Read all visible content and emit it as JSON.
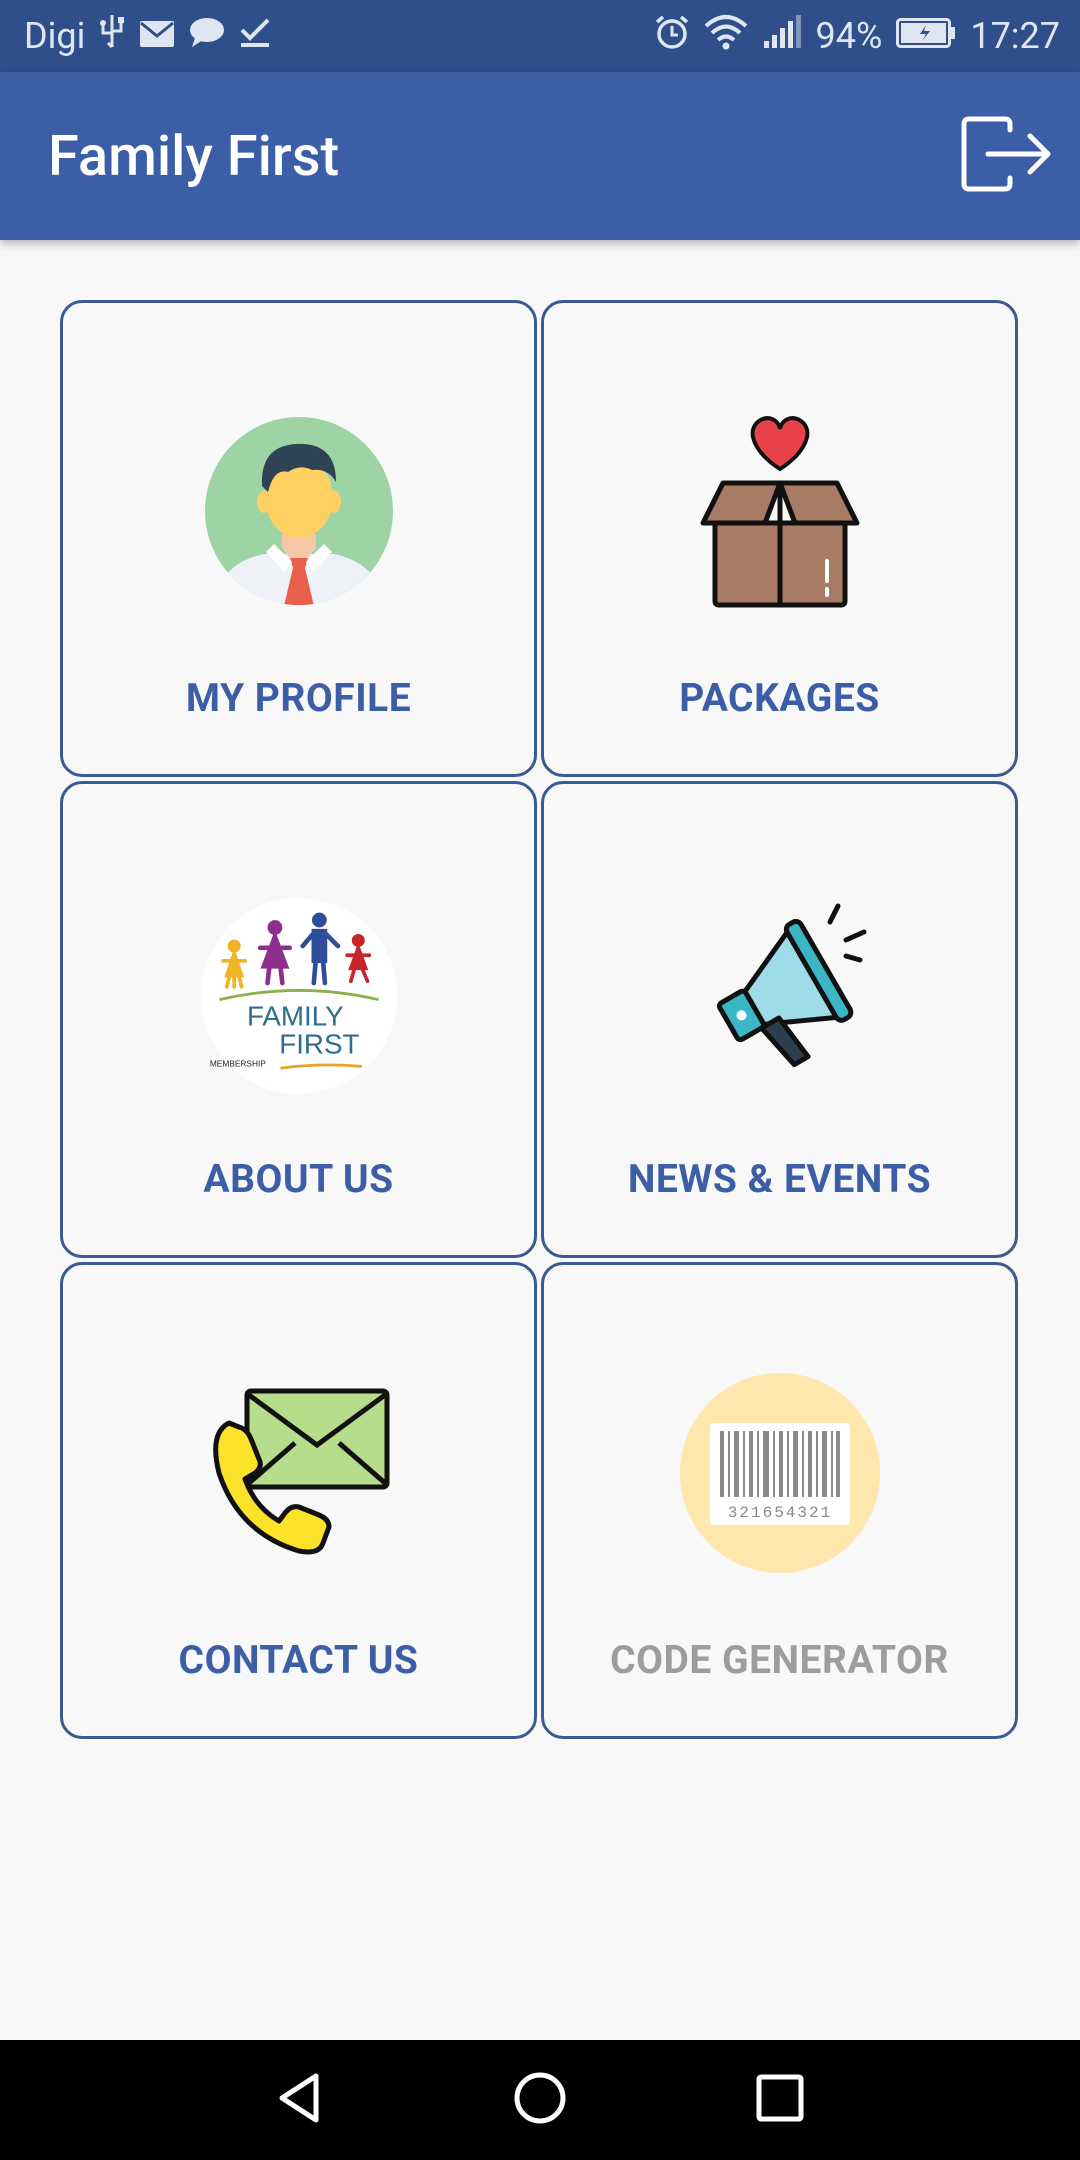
{
  "status_bar": {
    "carrier": "Digi",
    "battery_percent": "94%",
    "time": "17:27",
    "icons_left": [
      "usb-icon",
      "mail-icon",
      "chat-icon",
      "check-icon"
    ],
    "icons_right": [
      "alarm-icon",
      "wifi-icon",
      "signal-icon",
      "battery-icon"
    ]
  },
  "app_bar": {
    "title": "Family First",
    "action_icon": "logout-icon",
    "color": "#3b5ea6"
  },
  "tiles": [
    {
      "label": "MY PROFILE",
      "icon": "profile-avatar-icon",
      "enabled": true
    },
    {
      "label": "PACKAGES",
      "icon": "gift-box-heart-icon",
      "enabled": true
    },
    {
      "label": "ABOUT US",
      "icon": "family-first-logo",
      "enabled": true,
      "logo_text": [
        "FAMILY",
        "FIRST",
        "MEMBERSHIP"
      ]
    },
    {
      "label": "NEWS & EVENTS",
      "icon": "megaphone-icon",
      "enabled": true
    },
    {
      "label": "CONTACT US",
      "icon": "phone-envelope-icon",
      "enabled": true
    },
    {
      "label": "CODE GENERATOR",
      "icon": "barcode-icon",
      "enabled": false,
      "barcode_number": "321654321"
    }
  ],
  "nav_bar": {
    "buttons": [
      "back-icon",
      "home-icon",
      "recents-icon"
    ]
  }
}
